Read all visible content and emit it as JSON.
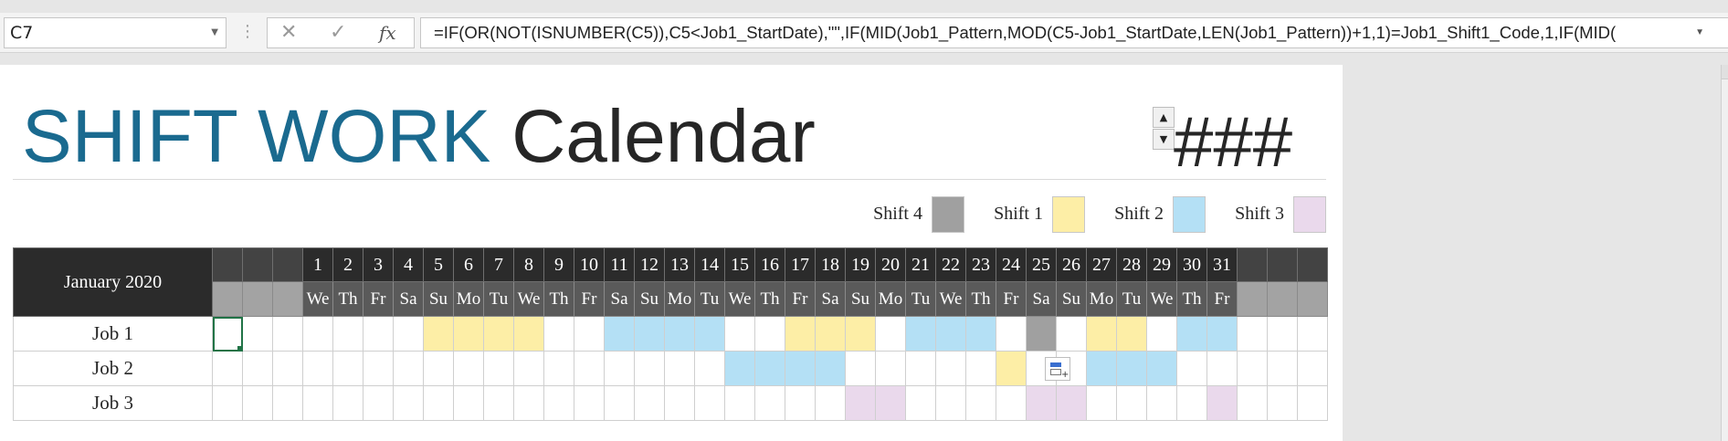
{
  "formula_bar": {
    "name_box": "C7",
    "formula": "=IF(OR(NOT(ISNUMBER(C5)),C5<Job1_StartDate),\"\",IF(MID(Job1_Pattern,MOD(C5-Job1_StartDate,LEN(Job1_Pattern))+1,1)=Job1_Shift1_Code,1,IF(MID(",
    "cancel_icon": "close-icon",
    "enter_icon": "checkmark-icon",
    "fx_label": "fx"
  },
  "header": {
    "title_part1": "SHIFT WORK",
    "title_part2": "Calendar",
    "year_display": "###",
    "spin_up": "▲",
    "spin_down": "▼"
  },
  "colors": {
    "title_accent": "#1a6a8f",
    "shift1": "#fdeea6",
    "shift2": "#b4e0f5",
    "shift3": "#ead9ec",
    "shift4": "#a0a0a0"
  },
  "legend": [
    {
      "label": "Shift 4",
      "color": "#a0a0a0"
    },
    {
      "label": "Shift 1",
      "color": "#fdeea6"
    },
    {
      "label": "Shift 2",
      "color": "#b4e0f5"
    },
    {
      "label": "Shift 3",
      "color": "#ead9ec"
    }
  ],
  "calendar": {
    "month_label": "January 2020",
    "leading_empty": 3,
    "trailing_empty": 3,
    "days": [
      "1",
      "2",
      "3",
      "4",
      "5",
      "6",
      "7",
      "8",
      "9",
      "10",
      "11",
      "12",
      "13",
      "14",
      "15",
      "16",
      "17",
      "18",
      "19",
      "20",
      "21",
      "22",
      "23",
      "24",
      "25",
      "26",
      "27",
      "28",
      "29",
      "30",
      "31"
    ],
    "weekdays": [
      "We",
      "Th",
      "Fr",
      "Sa",
      "Su",
      "Mo",
      "Tu",
      "We",
      "Th",
      "Fr",
      "Sa",
      "Su",
      "Mo",
      "Tu",
      "We",
      "Th",
      "Fr",
      "Sa",
      "Su",
      "Mo",
      "Tu",
      "We",
      "Th",
      "Fr",
      "Sa",
      "Su",
      "Mo",
      "Tu",
      "We",
      "Th",
      "Fr"
    ],
    "jobs": [
      {
        "label": "Job 1",
        "shifts": [
          "",
          "",
          "",
          "",
          "1",
          "1",
          "1",
          "1",
          "",
          "",
          "2",
          "2",
          "2",
          "2",
          "",
          "",
          "1",
          "1",
          "1",
          "",
          "2",
          "2",
          "2",
          "",
          "4",
          "",
          "1",
          "1",
          "",
          "2",
          "2"
        ]
      },
      {
        "label": "Job 2",
        "shifts": [
          "",
          "",
          "",
          "",
          "",
          "",
          "",
          "",
          "",
          "",
          "",
          "",
          "",
          "",
          "2",
          "2",
          "2",
          "2",
          "",
          "",
          "",
          "",
          "",
          "1",
          "",
          "",
          "2",
          "2",
          "2",
          "",
          ""
        ]
      },
      {
        "label": "Job 3",
        "shifts": [
          "",
          "",
          "",
          "",
          "",
          "",
          "",
          "",
          "",
          "",
          "",
          "",
          "",
          "",
          "",
          "",
          "",
          "",
          "3",
          "3",
          "",
          "",
          "",
          "",
          "3",
          "3",
          "",
          "",
          "",
          "",
          "3"
        ]
      }
    ]
  }
}
